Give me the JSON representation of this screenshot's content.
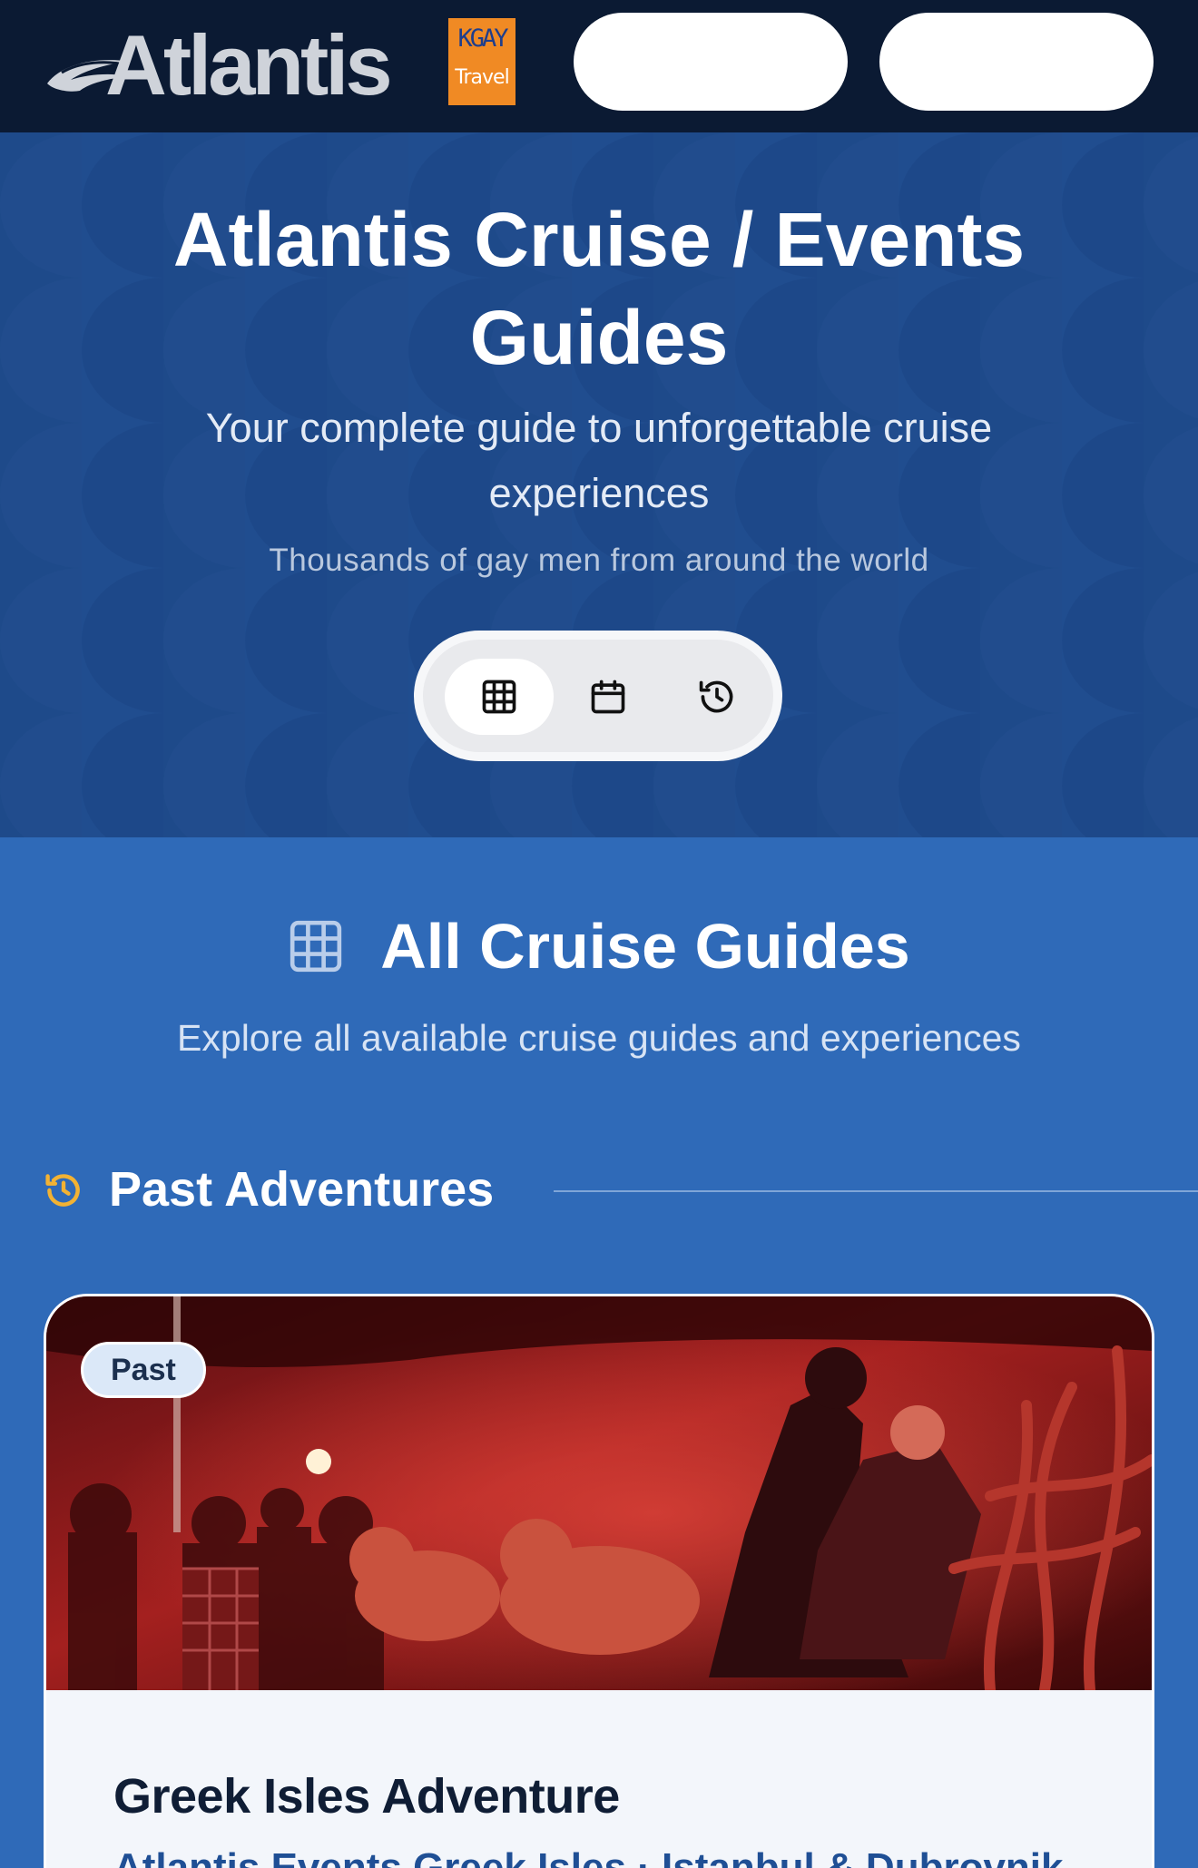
{
  "header": {
    "logo_text": "Atlantis",
    "partner_logo_line1": "KGAY",
    "partner_logo_line2": "Travel"
  },
  "hero": {
    "title": "Atlantis Cruise / Events Guides",
    "subtitle": "Your complete guide to unforgettable cruise experiences",
    "tagline": "Thousands of gay men from around the world",
    "view_toggle": [
      {
        "icon": "grid-icon",
        "active": true
      },
      {
        "icon": "calendar-icon",
        "active": false
      },
      {
        "icon": "history-icon",
        "active": false
      }
    ]
  },
  "section": {
    "icon": "grid-icon",
    "title": "All Cruise Guides",
    "subtitle": "Explore all available cruise guides and experiences"
  },
  "group": {
    "icon": "history-icon",
    "title": "Past Adventures"
  },
  "cards": [
    {
      "badge": "Past",
      "title": "Greek Isles Adventure",
      "link_text": "Atlantis Events Greek Isles · Istanbul & Dubrovnik",
      "image_description_icon": "photo-icon"
    }
  ],
  "colors": {
    "nav_bg": "#0b1a33",
    "hero_bg": "#1e4a8a",
    "page_bg": "#2f6ab8",
    "accent_gold": "#f2b233",
    "partner_orange": "#f08a24"
  }
}
